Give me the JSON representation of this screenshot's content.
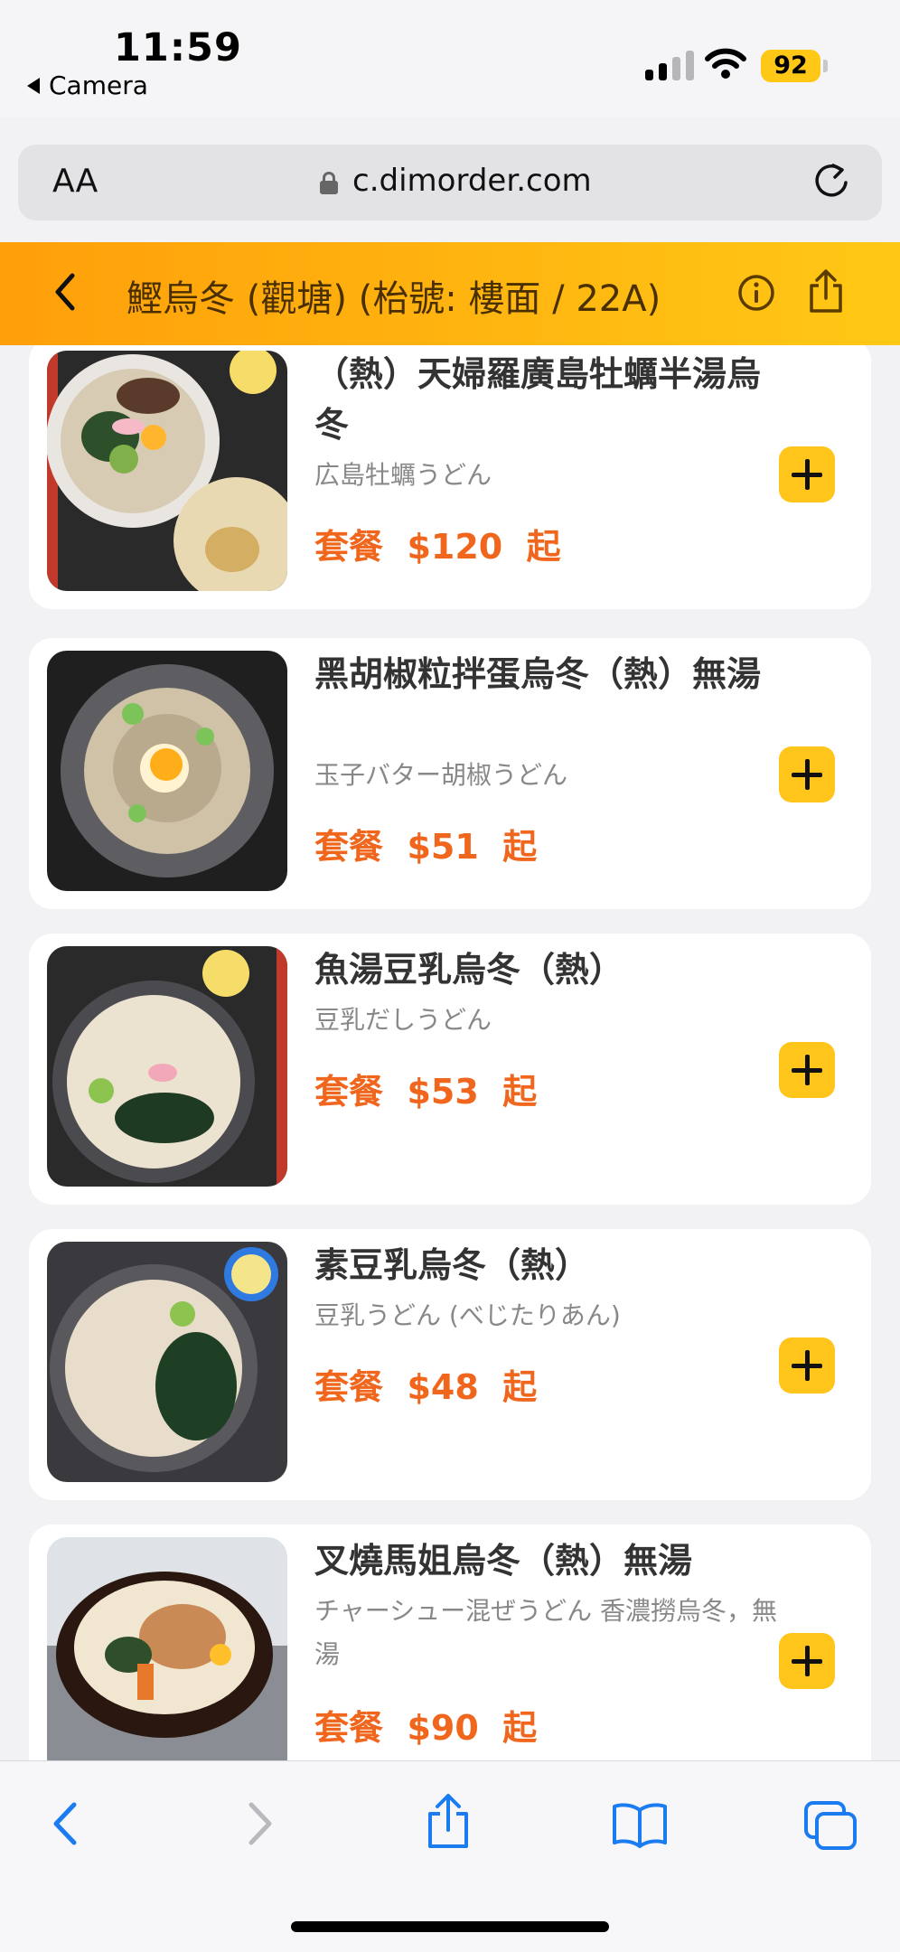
{
  "status_bar": {
    "time": "11:59",
    "back_app": "Camera",
    "battery": "92"
  },
  "browser": {
    "text_size_label": "AA",
    "url": "c.dimorder.com"
  },
  "header": {
    "title": "鰹烏冬 (觀塘) (枱號: 樓面 / 22A)"
  },
  "menu_items": [
    {
      "name": "（熱）天婦羅廣島牡蠣半湯烏冬",
      "subtitle": "広島牡蠣うどん",
      "price": "套餐  $120  起"
    },
    {
      "name": "黑胡椒粒拌蛋烏冬（熱）無湯",
      "subtitle": "玉子バター胡椒うどん",
      "price": "套餐  $51  起"
    },
    {
      "name": "魚湯豆乳烏冬（熱）",
      "subtitle": "豆乳だしうどん",
      "price": "套餐  $53  起"
    },
    {
      "name": "素豆乳烏冬（熱）",
      "subtitle": "豆乳うどん (べじたりあん)",
      "price": "套餐  $48  起"
    },
    {
      "name": "叉燒馬姐烏冬（熱）無湯",
      "subtitle": "チャーシュー混ぜうどん 香濃撈烏冬，無湯",
      "price": "套餐  $90  起"
    }
  ],
  "colors": {
    "header_start": "#ff9f0a",
    "header_end": "#ffc815",
    "price": "#f0661c",
    "add_button": "#ffc51a",
    "accent_blue": "#1a7cf0"
  }
}
